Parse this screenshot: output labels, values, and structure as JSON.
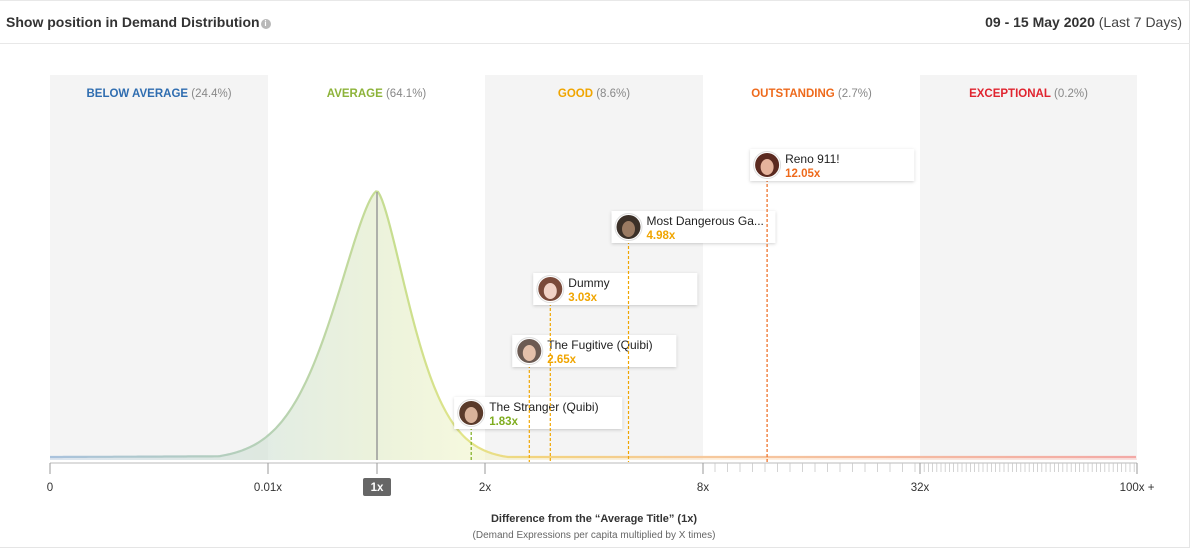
{
  "header": {
    "title": "Show position in Demand Distribution",
    "date_range": "09 - 15 May 2020",
    "date_note": "(Last 7 Days)",
    "info_icon": "info-icon"
  },
  "chart_data": {
    "type": "area",
    "title": "Show position in Demand Distribution",
    "xlabel": "Difference from the “Average Title” (1x)",
    "xlabel_note": "(Demand Expressions per capita multiplied by X times)",
    "ticks": [
      "0",
      "0.01x",
      "1x",
      "2x",
      "8x",
      "32x",
      "100x +"
    ],
    "highlighted_tick": "1x",
    "bands": [
      {
        "label": "BELOW AVERAGE",
        "pct": "(24.4%)",
        "color": "#2f6db0"
      },
      {
        "label": "AVERAGE",
        "pct": "(64.1%)",
        "color": "#8db33a"
      },
      {
        "label": "GOOD",
        "pct": "(8.6%)",
        "color": "#f0a500"
      },
      {
        "label": "OUTSTANDING",
        "pct": "(2.7%)",
        "color": "#ee6a1c"
      },
      {
        "label": "EXCEPTIONAL",
        "pct": "(0.2%)",
        "color": "#e0242f"
      }
    ],
    "shows": [
      {
        "name": "The Stranger (Quibi)",
        "value_label": "1.83x",
        "value": 1.83,
        "color": "#7fad1f"
      },
      {
        "name": "The Fugitive (Quibi)",
        "value_label": "2.65x",
        "value": 2.65,
        "color": "#f0a500"
      },
      {
        "name": "Dummy",
        "value_label": "3.03x",
        "value": 3.03,
        "color": "#f0a500"
      },
      {
        "name": "Most Dangerous Ga...",
        "value_label": "4.98x",
        "value": 4.98,
        "color": "#f0a500"
      },
      {
        "name": "Reno 911!",
        "value_label": "12.05x",
        "value": 12.05,
        "color": "#ee6a1c"
      }
    ]
  }
}
